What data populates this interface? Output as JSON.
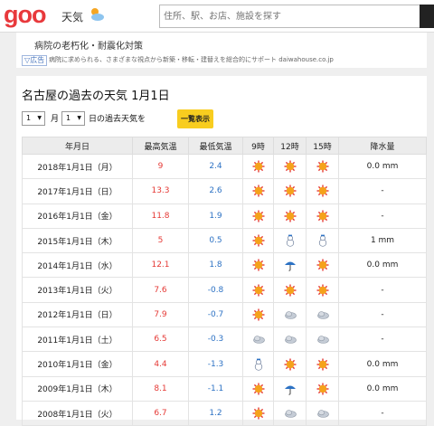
{
  "header": {
    "logo": "goo",
    "service": "天気",
    "search_placeholder": "住所、駅、お店、施設を探す"
  },
  "ad": {
    "title": "病院の老朽化・耐震化対策",
    "badge": "▽広告",
    "text": "病院に求められる、さまざまな視点から新築・移転・建替えを総合的にサポート daiwahouse.co.jp"
  },
  "page_title": "名古屋の過去の天気 1月1日",
  "filter": {
    "month": "1",
    "month_label": "月",
    "day": "1",
    "day_label": "日の過去天気を",
    "button": "一覧表示"
  },
  "table": {
    "headers": [
      "年月日",
      "最高気温",
      "最低気温",
      "9時",
      "12時",
      "15時",
      "降水量"
    ],
    "rows": [
      {
        "date": "2018年1月1日（月）",
        "high": "9",
        "low": "2.4",
        "w9": "sun",
        "w12": "sun",
        "w15": "sun",
        "rain": "0.0 mm"
      },
      {
        "date": "2017年1月1日（日）",
        "high": "13.3",
        "low": "2.6",
        "w9": "sun",
        "w12": "sun",
        "w15": "sun",
        "rain": "-"
      },
      {
        "date": "2016年1月1日（金）",
        "high": "11.8",
        "low": "1.9",
        "w9": "sun",
        "w12": "sun",
        "w15": "sun",
        "rain": "-"
      },
      {
        "date": "2015年1月1日（木）",
        "high": "5",
        "low": "0.5",
        "w9": "sun",
        "w12": "snow",
        "w15": "snow",
        "rain": "1 mm"
      },
      {
        "date": "2014年1月1日（水）",
        "high": "12.1",
        "low": "1.8",
        "w9": "sun",
        "w12": "rain",
        "w15": "sun",
        "rain": "0.0 mm"
      },
      {
        "date": "2013年1月1日（火）",
        "high": "7.6",
        "low": "-0.8",
        "w9": "sun",
        "w12": "sun",
        "w15": "sun",
        "rain": "-"
      },
      {
        "date": "2012年1月1日（日）",
        "high": "7.9",
        "low": "-0.7",
        "w9": "sun",
        "w12": "cloud",
        "w15": "cloud",
        "rain": "-"
      },
      {
        "date": "2011年1月1日（土）",
        "high": "6.5",
        "low": "-0.3",
        "w9": "cloud",
        "w12": "cloud",
        "w15": "cloud",
        "rain": "-"
      },
      {
        "date": "2010年1月1日（金）",
        "high": "4.4",
        "low": "-1.3",
        "w9": "snow",
        "w12": "sun",
        "w15": "sun",
        "rain": "0.0 mm"
      },
      {
        "date": "2009年1月1日（木）",
        "high": "8.1",
        "low": "-1.1",
        "w9": "sun",
        "w12": "rain",
        "w15": "sun",
        "rain": "0.0 mm"
      },
      {
        "date": "2008年1月1日（火）",
        "high": "6.7",
        "low": "1.2",
        "w9": "sun",
        "w12": "cloud",
        "w15": "cloud",
        "rain": "-"
      }
    ]
  },
  "colors": {
    "brand": "#e8393c",
    "high": "#e53935",
    "low": "#2d72c4",
    "button": "#f8cd1f"
  }
}
